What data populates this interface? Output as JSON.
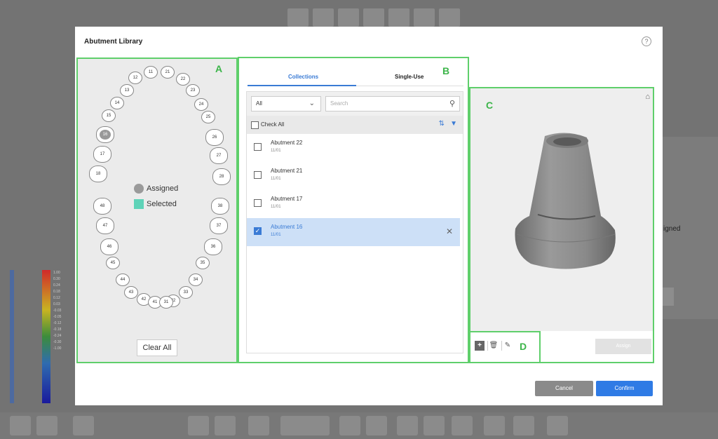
{
  "modal": {
    "title": "Abutment Library",
    "help": "?"
  },
  "labels": {
    "a": "A",
    "b": "B",
    "c": "C",
    "d": "D"
  },
  "teeth": {
    "upper": [
      "11",
      "21",
      "12",
      "22",
      "13",
      "23",
      "14",
      "24",
      "15",
      "25",
      "16",
      "26",
      "17",
      "27",
      "18",
      "28"
    ],
    "lower": [
      "48",
      "38",
      "47",
      "37",
      "46",
      "36",
      "45",
      "35",
      "44",
      "34",
      "43",
      "33",
      "42",
      "32",
      "41",
      "31"
    ],
    "assigned_tooth": "16"
  },
  "legend": {
    "assigned": "Assigned",
    "selected": "Selected",
    "assigned_color": "#9a9a9a",
    "selected_color": "#5fd3b8"
  },
  "clear_all": "Clear All",
  "tabs": {
    "collections": "Collections",
    "single_use": "Single-Use"
  },
  "filter": {
    "selected": "All",
    "search_placeholder": "Search"
  },
  "check_all": "Check All",
  "items": [
    {
      "name": "Abutment 22",
      "sub": "11/01"
    },
    {
      "name": "Abutment 21",
      "sub": "11/01"
    },
    {
      "name": "Abutment 17",
      "sub": "11/01"
    },
    {
      "name": "Abutment 16",
      "sub": "11/01",
      "selected": true
    }
  ],
  "assign_button": "Assign",
  "footer": {
    "cancel": "Cancel",
    "confirm": "Confirm"
  },
  "background": {
    "assigned_fragment": "igned"
  },
  "scale_values": [
    "1.00",
    "0.30",
    "0.24",
    "0.18",
    "0.12",
    "0.03",
    "-0.03",
    "-0.05",
    "-0.12",
    "-0.18",
    "-0.24",
    "-0.30",
    "-1.00"
  ]
}
